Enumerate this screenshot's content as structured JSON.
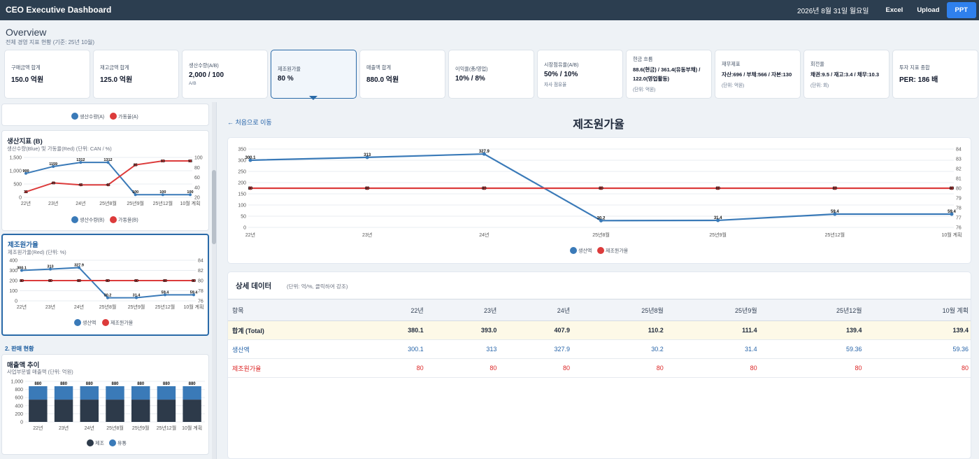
{
  "app": {
    "title": "CEO Executive Dashboard",
    "date": "2026년 8월 31일 월요일",
    "buttons": {
      "excel": "Excel",
      "upload": "Upload",
      "ppt": "PPT"
    }
  },
  "overview": {
    "title": "Overview",
    "subtitle": "전체 경영 지표 현황 (기준: 25년 10월)"
  },
  "kpis": [
    {
      "label": "구매금액 합계",
      "value": "150.0 억원",
      "note": ""
    },
    {
      "label": "재고금액 합계",
      "value": "125.0 억원",
      "note": ""
    },
    {
      "label": "생산수량(A/B)",
      "value": "2,000 / 100",
      "note": "A/B"
    },
    {
      "label": "제조원가율",
      "value": "80 %",
      "note": ""
    },
    {
      "label": "매출액 합계",
      "value": "880.0 억원",
      "note": ""
    },
    {
      "label": "이익율(총/영업)",
      "value": "10% / 8%",
      "note": ""
    },
    {
      "label": "시장점유율(A/B)",
      "value": "50% / 10%",
      "note": "자사 점유율"
    },
    {
      "label": "현금 흐름",
      "value": "88.6(현금) / 361.4(유동부채) / 122.0(영업활동)",
      "note": "(단위: 억원)"
    },
    {
      "label": "재무제표",
      "value": "자산:696 / 부채:566 / 자본:130",
      "note": "(단위: 억원)"
    },
    {
      "label": "회전율",
      "value": "채권:9.5 / 재고:3.4 / 채무:10.3",
      "note": "(단위: 회)"
    },
    {
      "label": "투자 지표 종합",
      "value": "PER: 186 배",
      "note": ""
    }
  ],
  "left": {
    "top_legend": {
      "a": "생산수량(A)",
      "b": "가동율(A)"
    },
    "prodB": {
      "title": "생산지표 (B)",
      "subtitle": "생산수량(Blue) 및 가동율(Red) (단위: CAN / %)",
      "chart_data": {
        "type": "line",
        "categories": [
          "22년",
          "23년",
          "24년",
          "25년8월",
          "25년9월",
          "25년12월",
          "10월 계획"
        ],
        "series": [
          {
            "name": "생산수량(B)",
            "axis": "left",
            "values": [
              900,
              1159,
              1312,
              1312,
              100,
              100,
              100
            ]
          },
          {
            "name": "가동율(B)",
            "axis": "right",
            "values": [
              31,
              49,
              45,
              45,
              85,
              93,
              93
            ]
          }
        ],
        "ylim_left": [
          0,
          1500
        ],
        "ylim_right": [
          20,
          100
        ],
        "yticks_left": [
          "0",
          "500",
          "1,000",
          "1,500"
        ],
        "yticks_right": [
          "20",
          "40",
          "60",
          "80",
          "100"
        ]
      },
      "labels_blue": [
        "900",
        "1159",
        "1312",
        "1312",
        "100",
        "100",
        "100"
      ],
      "labels_red": [
        "31",
        "49",
        "45",
        "45",
        "85",
        "93",
        "93"
      ],
      "legend": {
        "a": "생산수량(B)",
        "b": "가동율(B)"
      }
    },
    "mfg": {
      "title": "제조원가율",
      "subtitle": "제조원가율(Red) (단위: %)",
      "chart_data": {
        "type": "line",
        "categories": [
          "22년",
          "23년",
          "24년",
          "25년8월",
          "25년9월",
          "25년12월",
          "10월 계획"
        ],
        "series": [
          {
            "name": "생산액",
            "axis": "left",
            "values": [
              300.1,
              313,
              327.9,
              30.2,
              31.4,
              59.4,
              59.4
            ]
          },
          {
            "name": "제조원가율",
            "axis": "right",
            "values": [
              80,
              80,
              80,
              80,
              80,
              80,
              80
            ]
          }
        ],
        "ylim_left": [
          0,
          400
        ],
        "ylim_right": [
          76,
          84
        ],
        "yticks_left": [
          "0",
          "100",
          "200",
          "300",
          "400"
        ],
        "yticks_right": [
          "76",
          "78",
          "80",
          "82",
          "84"
        ]
      },
      "labels_blue": [
        "300.1",
        "313",
        "327.9",
        "30.2",
        "31.4",
        "59.4",
        "59.4"
      ],
      "labels_red": [
        "80",
        "80",
        "80",
        "80",
        "80",
        "80",
        "80"
      ],
      "legend": {
        "a": "생산액",
        "b": "제조원가율"
      }
    },
    "section_sales": "2. 판매 현황",
    "sales": {
      "title": "매출액 추이",
      "subtitle": "사업부문별 매출액 (단위: 억원)",
      "chart_data": {
        "type": "bar",
        "stacked": true,
        "categories": [
          "22년",
          "23년",
          "24년",
          "25년8월",
          "25년9월",
          "25년12월",
          "10월 계획"
        ],
        "series": [
          {
            "name": "제조",
            "values": [
              550,
              550,
              550,
              550,
              550,
              550,
              550
            ]
          },
          {
            "name": "유통",
            "values": [
              330,
              330,
              330,
              330,
              330,
              330,
              330
            ]
          }
        ],
        "totals": [
          880,
          880,
          880,
          880,
          880,
          880,
          880
        ],
        "ylim": [
          0,
          1000
        ],
        "yticks": [
          "0",
          "200",
          "400",
          "600",
          "800",
          "1,000"
        ]
      },
      "total_labels": [
        "880",
        "880",
        "880",
        "880",
        "880",
        "880",
        "880"
      ],
      "legend": {
        "a": "제조",
        "b": "유통"
      }
    }
  },
  "detail": {
    "back": "← 처음으로 이동",
    "title": "제조원가율",
    "chart_data": {
      "type": "line",
      "categories": [
        "22년",
        "23년",
        "24년",
        "25년8월",
        "25년9월",
        "25년12월",
        "10월 계획"
      ],
      "series": [
        {
          "name": "생산액",
          "axis": "left",
          "color": "#3a7ab8",
          "values": [
            300.1,
            313,
            327.9,
            30.2,
            31.4,
            59.4,
            59.4
          ]
        },
        {
          "name": "제조원가율",
          "axis": "right",
          "color": "#dc3b3b",
          "values": [
            80,
            80,
            80,
            80,
            80,
            80,
            80
          ]
        }
      ],
      "ylim_left": [
        0,
        350
      ],
      "ylim_right": [
        76,
        84
      ],
      "yticks_left": [
        "0",
        "50",
        "100",
        "150",
        "200",
        "250",
        "300",
        "350"
      ],
      "yticks_right": [
        "76",
        "77",
        "78",
        "79",
        "80",
        "81",
        "82",
        "83",
        "84"
      ],
      "grid": true,
      "legend_position": "bottom"
    },
    "labels_blue": [
      "300.1",
      "313",
      "327.9",
      "30.2",
      "31.4",
      "59.4",
      "59.4"
    ],
    "labels_red": [
      "80",
      "80",
      "80",
      "80",
      "80",
      "80",
      "80"
    ],
    "legend": {
      "a": "생산액",
      "b": "제조원가율"
    }
  },
  "table": {
    "title": "상세 데이터",
    "subtitle": "(단위: 억/%, 클릭하여 강조)",
    "headers": [
      "항목",
      "22년",
      "23년",
      "24년",
      "25년8월",
      "25년9월",
      "25년12월",
      "10월 계획"
    ],
    "rows": [
      {
        "cells": [
          "합계 (Total)",
          "380.1",
          "393.0",
          "407.9",
          "110.2",
          "111.4",
          "139.4",
          "139.4"
        ]
      },
      {
        "cells": [
          "생산액",
          "300.1",
          "313",
          "327.9",
          "30.2",
          "31.4",
          "59.36",
          "59.36"
        ]
      },
      {
        "cells": [
          "제조원가율",
          "80",
          "80",
          "80",
          "80",
          "80",
          "80",
          "80"
        ]
      }
    ]
  },
  "colors": {
    "topbar": "#2c3e50",
    "blue": "#3a7ab8",
    "red": "#dc3b3b",
    "navy": "#2d3a4a",
    "accent": "#2f80ed"
  }
}
